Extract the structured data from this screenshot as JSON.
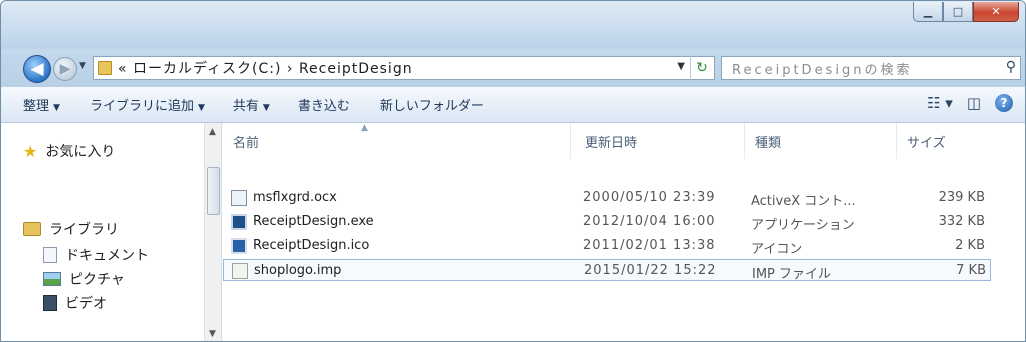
{
  "titlebar": {
    "minimize_glyph": "▁",
    "maximize_glyph": "□",
    "close_glyph": "✕"
  },
  "address": {
    "back_glyph": "◀",
    "forward_glyph": "▶",
    "path": "« ローカルディスク(C:) › ReceiptDesign",
    "search_placeholder": "ReceiptDesignの検索"
  },
  "commandbar": {
    "organize": "整理",
    "add_to_library": "ライブラリに追加",
    "share": "共有",
    "burn": "書き込む",
    "new_folder": "新しいフォルダー"
  },
  "navpane": {
    "favorites": "お気に入り",
    "libraries": "ライブラリ",
    "documents": "ドキュメント",
    "pictures": "ピクチャ",
    "videos": "ビデオ"
  },
  "columns": {
    "name": "名前",
    "date": "更新日時",
    "type": "種類",
    "size": "サイズ"
  },
  "files": [
    {
      "name": "msflxgrd.ocx",
      "date": "2000/05/10 23:39",
      "type": "ActiveX コント...",
      "size": "239 KB",
      "icon": "ocx-file-icon"
    },
    {
      "name": "ReceiptDesign.exe",
      "date": "2012/10/04 16:00",
      "type": "アプリケーション",
      "size": "332 KB",
      "icon": "exe-file-icon"
    },
    {
      "name": "ReceiptDesign.ico",
      "date": "2011/02/01 13:38",
      "type": "アイコン",
      "size": "2 KB",
      "icon": "ico-file-icon"
    },
    {
      "name": "shoplogo.imp",
      "date": "2015/01/22 15:22",
      "type": "IMP ファイル",
      "size": "7 KB",
      "icon": "imp-file-icon",
      "selected": true
    }
  ]
}
